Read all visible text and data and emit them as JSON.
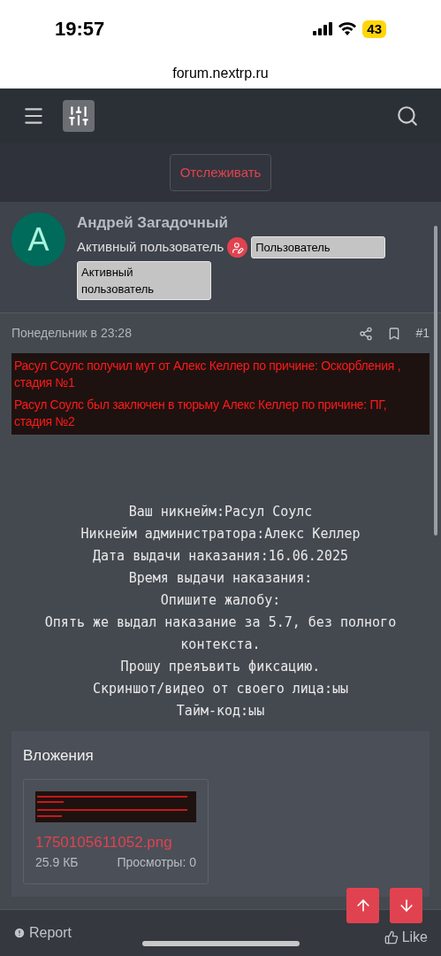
{
  "status_bar": {
    "time": "19:57",
    "battery": "43"
  },
  "address_bar": {
    "url": "forum.nextrp.ru"
  },
  "follow_button": "Отслеживать",
  "author": {
    "initial": "А",
    "name": "Андрей Загадочный",
    "title": "Активный пользователь",
    "badges": [
      "Пользователь",
      "Активный пользователь"
    ]
  },
  "post": {
    "date": "Понедельник в 23:28",
    "number": "#1",
    "embedded_lines": [
      "Расул Соулс получил мут от Алекс Келлер по причине: Оскорбления , стадия №1",
      "Расул Соулс был заключен в тюрьму Алекс Келлер по причине: ПГ, стадия №2"
    ],
    "body_lines": [
      "Ваш никнейм:Расул Соулс",
      "Никнейм администратора:Алекс Келлер",
      "Дата выдачи наказания:16.06.2025",
      "Время выдачи наказания:",
      "Опишите жалобу:",
      "Опять же выдал наказание за 5.7, без полного контекста.",
      "Прошу преяъвить фиксацию.",
      "Скриншот/видео от своего лица:ыы",
      "Тайм-код:ыы"
    ]
  },
  "attachments": {
    "title": "Вложения",
    "files": [
      {
        "kind": "picture",
        "name": "1750105611052.png",
        "size": "25.9 КБ",
        "views": "Просмотры: 0"
      }
    ]
  },
  "footer": {
    "report": "Report",
    "like": "Like"
  }
}
